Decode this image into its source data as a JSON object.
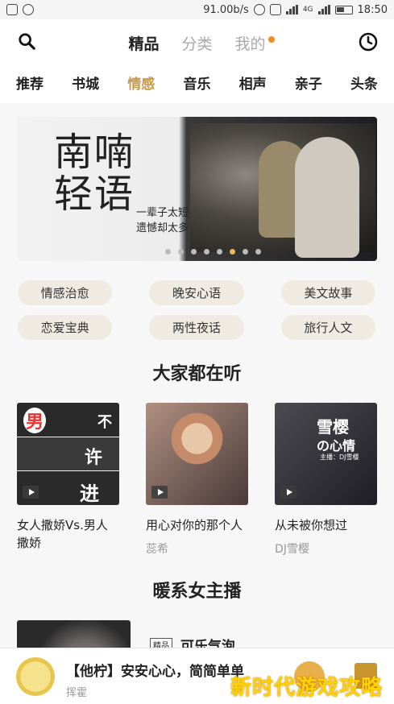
{
  "status_bar": {
    "speed": "91.00b/s",
    "network": "4G",
    "time": "18:50"
  },
  "top_nav": {
    "tabs": [
      {
        "label": "精品"
      },
      {
        "label": "分类"
      },
      {
        "label": "我的"
      }
    ]
  },
  "category_tabs": [
    "推荐",
    "书城",
    "情感",
    "音乐",
    "相声",
    "亲子",
    "头条"
  ],
  "banner": {
    "title_line1": "南喃",
    "title_line2": "轻语",
    "subtitle_line1": "一辈子太短",
    "subtitle_line2": "遗憾却太多",
    "dot_count": 8,
    "active_dot": 5
  },
  "tags": [
    "情感治愈",
    "晚安心语",
    "美文故事",
    "恋爱宝典",
    "两性夜话",
    "旅行人文"
  ],
  "section1": {
    "title": "大家都在听"
  },
  "cards": [
    {
      "cover_text": [
        "男",
        "不",
        "许",
        "进"
      ],
      "title": "女人撒娇Vs.男人撒娇",
      "author": ""
    },
    {
      "cover_text": [],
      "title": "用心对你的那个人",
      "author": "蕊希"
    },
    {
      "cover_text": [
        "雪樱",
        "の心情",
        "主播：DJ雪樱"
      ],
      "title": "从未被你想过",
      "author": "DJ雪樱"
    }
  ],
  "section2": {
    "title": "暖系女主播"
  },
  "anchor_item": {
    "badge": "精品",
    "title": "可乐气泡"
  },
  "player": {
    "title": "【他柠】安安心心，简简单单",
    "author": "挥霍"
  },
  "watermark": "新时代游戏攻略",
  "colors": {
    "accent": "#c79a4a",
    "badge_orange": "#f08a1c",
    "active_dot": "#e7b95a"
  }
}
